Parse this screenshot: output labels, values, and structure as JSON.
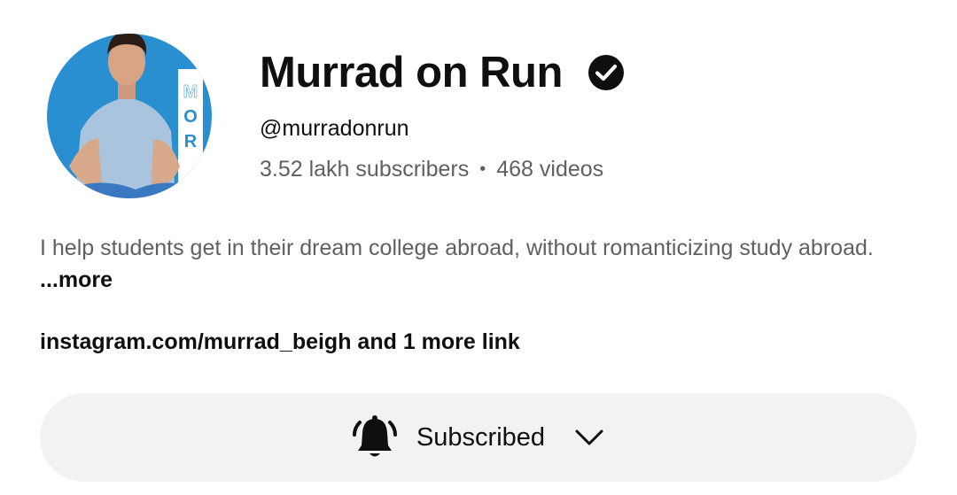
{
  "channel": {
    "name": "Murrad on Run",
    "handle": "@murradonrun",
    "subscribers": "3.52 lakh subscribers",
    "separator": "•",
    "videos": "468 videos",
    "avatar_initials": [
      "M",
      "O",
      "R"
    ],
    "description": "I help students  get in their dream college abroad,  without romanticizing study abroad.",
    "more_label": "...more",
    "links_text": "instagram.com/murrad_beigh and 1 more link"
  },
  "subscribe_button": {
    "label": "Subscribed",
    "icon": "bell-ringing-icon",
    "dropdown_icon": "chevron-down-icon"
  },
  "colors": {
    "avatar_bg": "#2a8fd0",
    "button_bg": "#f2f2f2",
    "secondary_text": "#606060",
    "primary_text": "#0f0f0f"
  }
}
